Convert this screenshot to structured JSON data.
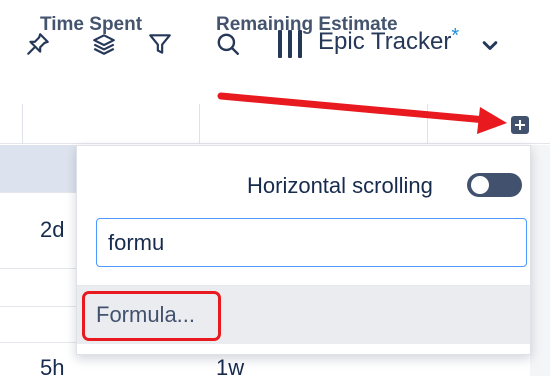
{
  "toolbar": {
    "icons": [
      "pin-icon",
      "layers-icon",
      "filter-icon",
      "search-icon",
      "columns-icon",
      "chevron-down-icon"
    ],
    "view_title": "Epic Tracker",
    "unsaved_marker": "*"
  },
  "table": {
    "headers": [
      "Time Spent",
      "Remaining Estimate"
    ],
    "rows": [
      {
        "time_spent": "",
        "remaining": "",
        "selected": true
      },
      {
        "time_spent": "2d",
        "remaining": ""
      },
      {
        "time_spent": "",
        "remaining": ""
      },
      {
        "time_spent": "",
        "remaining": ""
      },
      {
        "time_spent": "5h",
        "remaining": "1w"
      }
    ]
  },
  "popup": {
    "horizontal_scrolling_label": "Horizontal scrolling",
    "horizontal_scrolling_on": false,
    "search_value": "formu",
    "options": [
      "Formula..."
    ]
  },
  "annotations": {
    "arrow_color": "#e8191f",
    "highlight_color": "#e8191f"
  }
}
